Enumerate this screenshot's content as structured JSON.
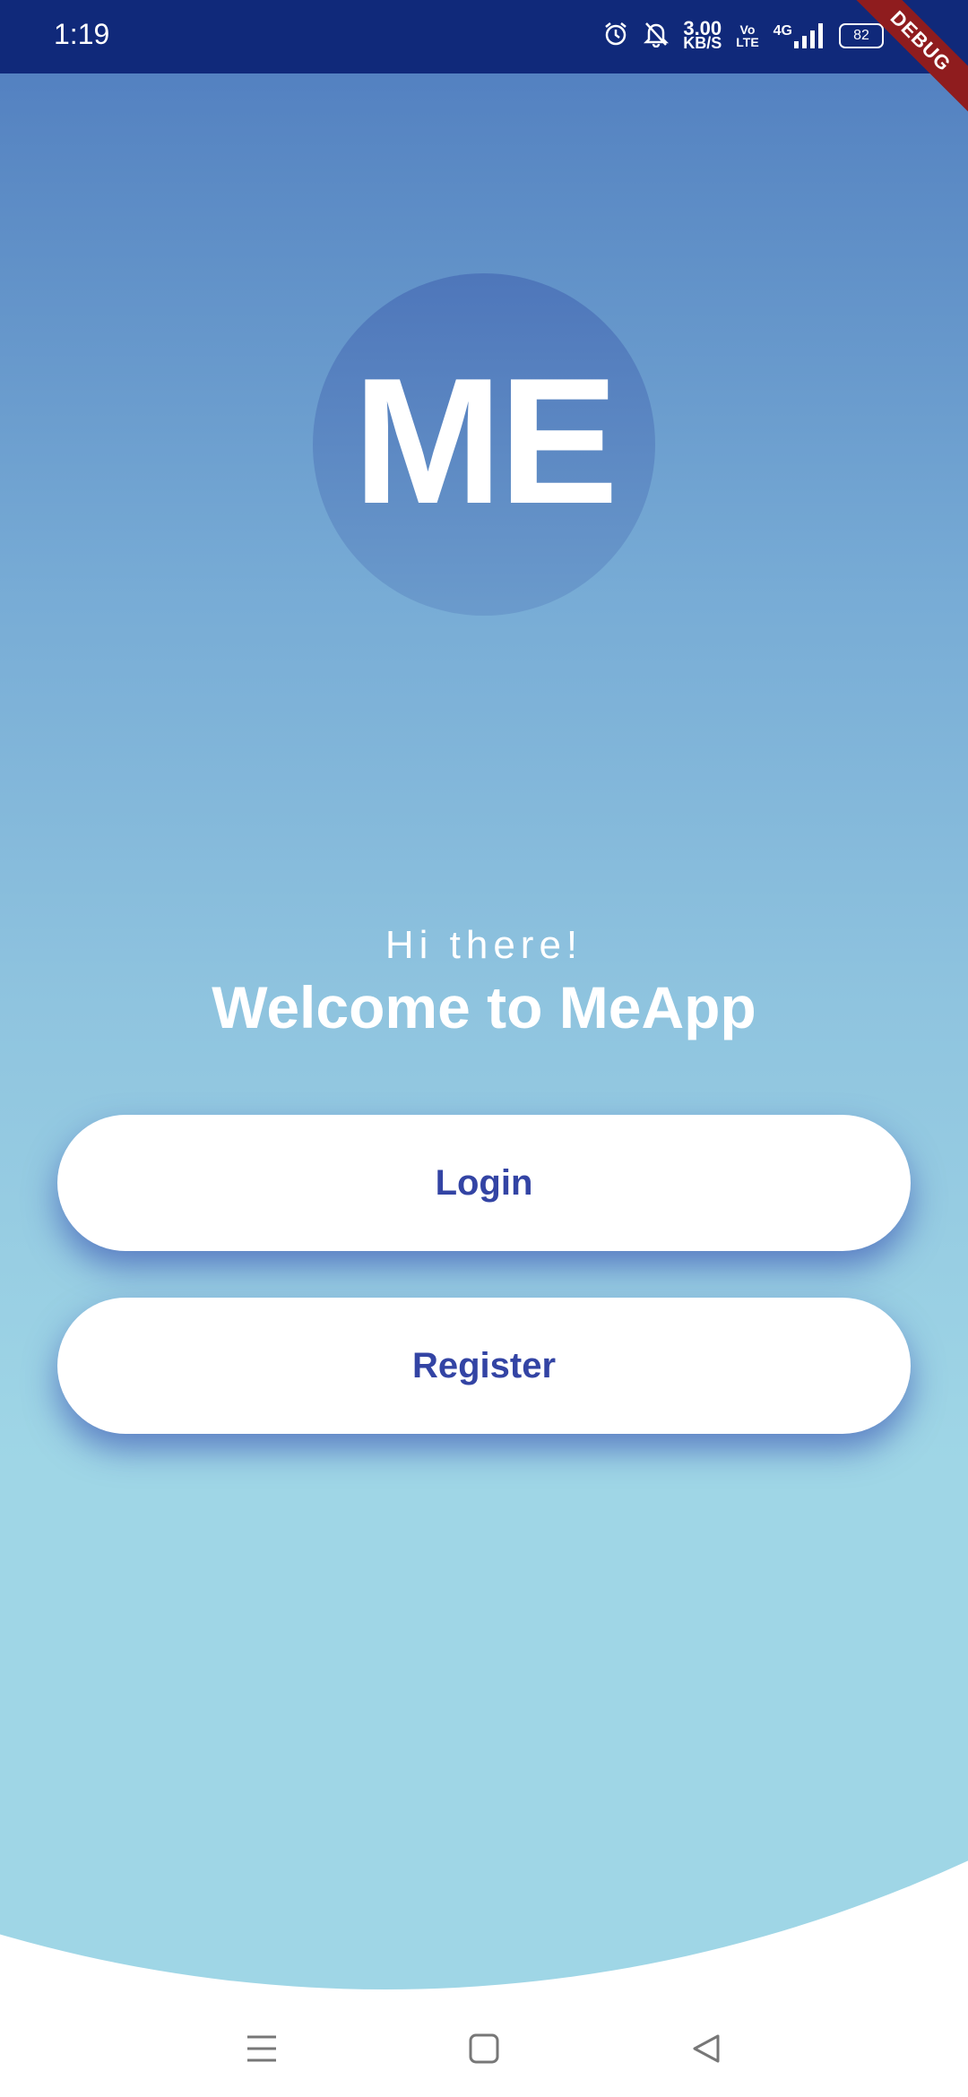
{
  "status_bar": {
    "time": "1:19",
    "speed_value": "3.00",
    "speed_unit": "KB/S",
    "volte_top": "Vo",
    "volte_bottom": "LTE",
    "network": "4G",
    "battery": "82",
    "icons": [
      "alarm-icon",
      "bell-off-icon",
      "signal-icon",
      "charging-icon"
    ]
  },
  "debug_banner": "DEBUG",
  "logo": {
    "text": "ME"
  },
  "greeting": "Hi there!",
  "welcome": "Welcome to MeApp",
  "buttons": {
    "login": "Login",
    "register": "Register"
  },
  "nav": {
    "icons": [
      "menu-icon",
      "home-square-icon",
      "back-triangle-icon"
    ]
  },
  "colors": {
    "status_bar": "#10297a",
    "gradient_top": "#1a3a9e",
    "gradient_bottom": "#9fd6e6",
    "button_text": "#3344a4",
    "button_bg": "#ffffff",
    "debug_ribbon": "#8f1c1e"
  }
}
